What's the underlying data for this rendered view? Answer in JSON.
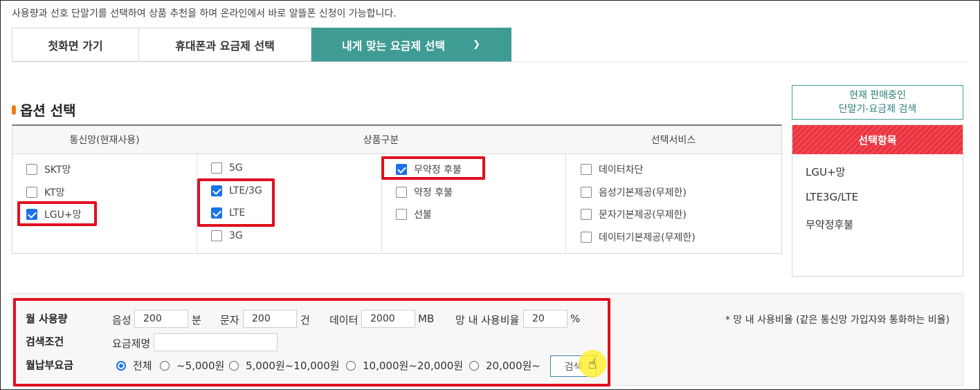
{
  "intro": "사용량과 선호 단말기를 선택하여 상품 추천을 하며 온라인에서 바로 알뜰폰 신청이 가능합니다.",
  "tabs": [
    {
      "label": "첫화면 가기"
    },
    {
      "label": "휴대폰과 요금제 선택"
    },
    {
      "label": "내게 맞는 요금제 선택",
      "icon": "chevron-down-icon"
    }
  ],
  "section_title": "옵션 선택",
  "search_button": {
    "line1": "현재 판매중인",
    "line2": "단말기-요금제 검색"
  },
  "columns": {
    "network": "통신망(현재사용)",
    "product": "상품구분",
    "service": "선택서비스"
  },
  "network_options": [
    {
      "label": "SKT망",
      "checked": false
    },
    {
      "label": "KT망",
      "checked": false
    },
    {
      "label": "LGU+망",
      "checked": true
    }
  ],
  "gen_options": [
    {
      "label": "5G",
      "checked": false
    },
    {
      "label": "LTE/3G",
      "checked": true
    },
    {
      "label": "LTE",
      "checked": true
    },
    {
      "label": "3G",
      "checked": false
    }
  ],
  "contract_options": [
    {
      "label": "무약정 후불",
      "checked": true
    },
    {
      "label": "약정 후불",
      "checked": false
    },
    {
      "label": "선불",
      "checked": false
    }
  ],
  "service_options": [
    {
      "label": "데이터차단",
      "checked": false
    },
    {
      "label": "음성기본제공(무제한)",
      "checked": false
    },
    {
      "label": "문자기본제공(무제한)",
      "checked": false
    },
    {
      "label": "데이터기본제공(무제한)",
      "checked": false
    }
  ],
  "selected_panel": {
    "title": "선택항목",
    "items": [
      "LGU+망",
      "LTE3G/LTE",
      "무약정후불"
    ]
  },
  "filter": {
    "usage_label": "월 사용량",
    "voice_label": "음성",
    "voice_value": "200",
    "voice_unit": "분",
    "sms_label": "문자",
    "sms_value": "200",
    "sms_unit": "건",
    "data_label": "데이터",
    "data_value": "2000",
    "data_unit": "MB",
    "ratio_label": "망 내 사용비율",
    "ratio_value": "20",
    "ratio_unit": "%",
    "note": "* 망 내 사용비율 (같은 통신망 가입자와 통화하는 비율)",
    "search_cond_label": "검색조건",
    "plan_name_label": "요금제명",
    "plan_name_value": "",
    "fee_label": "월납부요금",
    "fee_options": [
      {
        "label": "전체",
        "checked": true
      },
      {
        "label": "~5,000원",
        "checked": false
      },
      {
        "label": "5,000원~10,000원",
        "checked": false
      },
      {
        "label": "10,000원~20,000원",
        "checked": false
      },
      {
        "label": "20,000원~",
        "checked": false
      }
    ],
    "go_button": "검색"
  },
  "colors": {
    "accent": "#3f9c94",
    "highlight": "#e0101f",
    "checkbox": "#1a73e8",
    "selected_head": "#ee3c47"
  }
}
